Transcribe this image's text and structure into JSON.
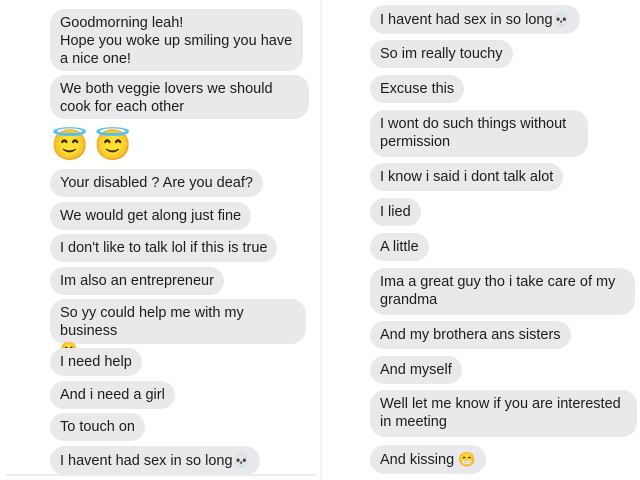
{
  "colors": {
    "bubble": "#e9e9eb",
    "text": "#1c1c1c",
    "background": "#ffffff"
  },
  "left": {
    "messages": [
      {
        "text": "Goodmorning leah!\nHope you woke up smiling you have a nice one!"
      },
      {
        "text": "We both veggie lovers we should cook for each other"
      },
      {
        "text": "Your disabled ? Are you deaf?"
      },
      {
        "text": "We would get along just fine"
      },
      {
        "text": "I don't like to talk lol if this is true"
      },
      {
        "text": "Im also an entrepreneur"
      },
      {
        "text": "So yy could help me with my business",
        "emoji": "😁"
      },
      {
        "text": "I need help"
      },
      {
        "text": "And i need a girl"
      },
      {
        "text": "To touch on"
      },
      {
        "text": "I havent had sex in so long",
        "emoji": "💀"
      }
    ],
    "emoji_message": "😇😇"
  },
  "right": {
    "messages": [
      {
        "text": "I havent had sex in so long",
        "emoji": "💀"
      },
      {
        "text": "So im really touchy"
      },
      {
        "text": "Excuse this"
      },
      {
        "text": "I wont do such things without permission"
      },
      {
        "text": "I know i said i dont talk alot"
      },
      {
        "text": "I lied"
      },
      {
        "text": "A little"
      },
      {
        "text": "Ima a great guy tho i take care of my grandma"
      },
      {
        "text": "And my brothera ans sisters"
      },
      {
        "text": "And myself"
      },
      {
        "text": "Well let me know if you are interested in meeting"
      },
      {
        "text": "And kissing",
        "emoji": "😁"
      }
    ]
  }
}
